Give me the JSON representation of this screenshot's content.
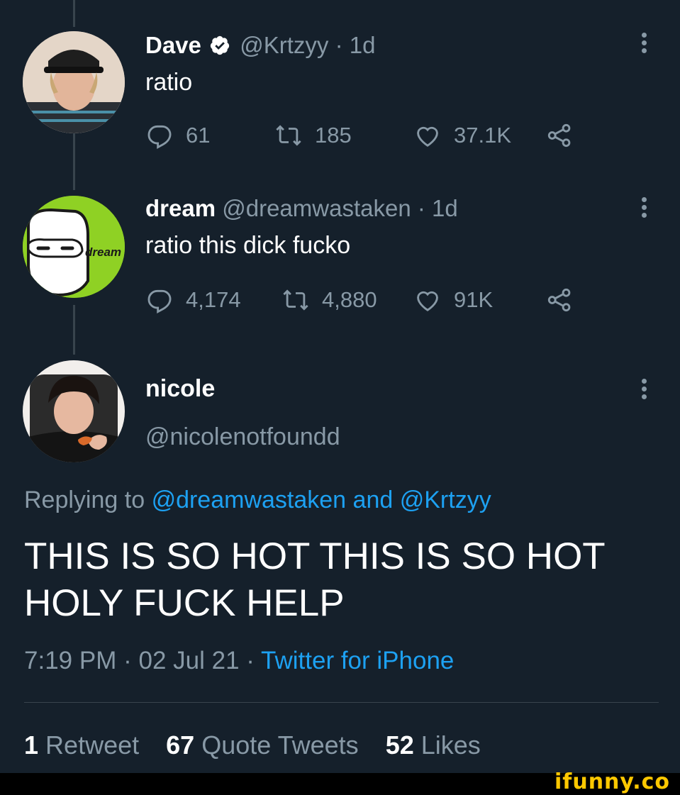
{
  "tweets": [
    {
      "name": "Dave",
      "verified": true,
      "handle": "@Krtzyy",
      "sep": "·",
      "time": "1d",
      "text": "ratio",
      "replies": "61",
      "retweets": "185",
      "likes": "37.1K"
    },
    {
      "name": "dream",
      "handle": "@dreamwastaken",
      "sep": "·",
      "time": "1d",
      "avatar_label": "dream",
      "text": "ratio this dick fucko",
      "replies": "4,174",
      "retweets": "4,880",
      "likes": "91K"
    }
  ],
  "main_tweet": {
    "name": "nicole",
    "handle": "@nicolenotfoundd",
    "replying_prefix": "Replying to",
    "reply_to_1": "@dreamwastaken",
    "reply_and": "and",
    "reply_to_2": "@Krtzyy",
    "text_line1": "THIS IS SO HOT THIS IS SO HOT",
    "text_line2": "HOLY FUCK HELP",
    "time": "7:19 PM",
    "sep": "·",
    "date": "02 Jul 21",
    "source": "Twitter for iPhone"
  },
  "stats": {
    "retweets_count": "1",
    "retweets_label": "Retweet",
    "quotes_count": "67",
    "quotes_label": "Quote Tweets",
    "likes_count": "52",
    "likes_label": "Likes"
  },
  "watermark": "ifunny.co",
  "colors": {
    "background": "#15202b",
    "accent": "#1da1f2",
    "secondary_text": "#8899a6",
    "dream_green": "#8fd124"
  },
  "icons": [
    "reply-icon",
    "retweet-icon",
    "like-icon",
    "share-icon",
    "verified-badge-icon",
    "more-options-icon"
  ]
}
